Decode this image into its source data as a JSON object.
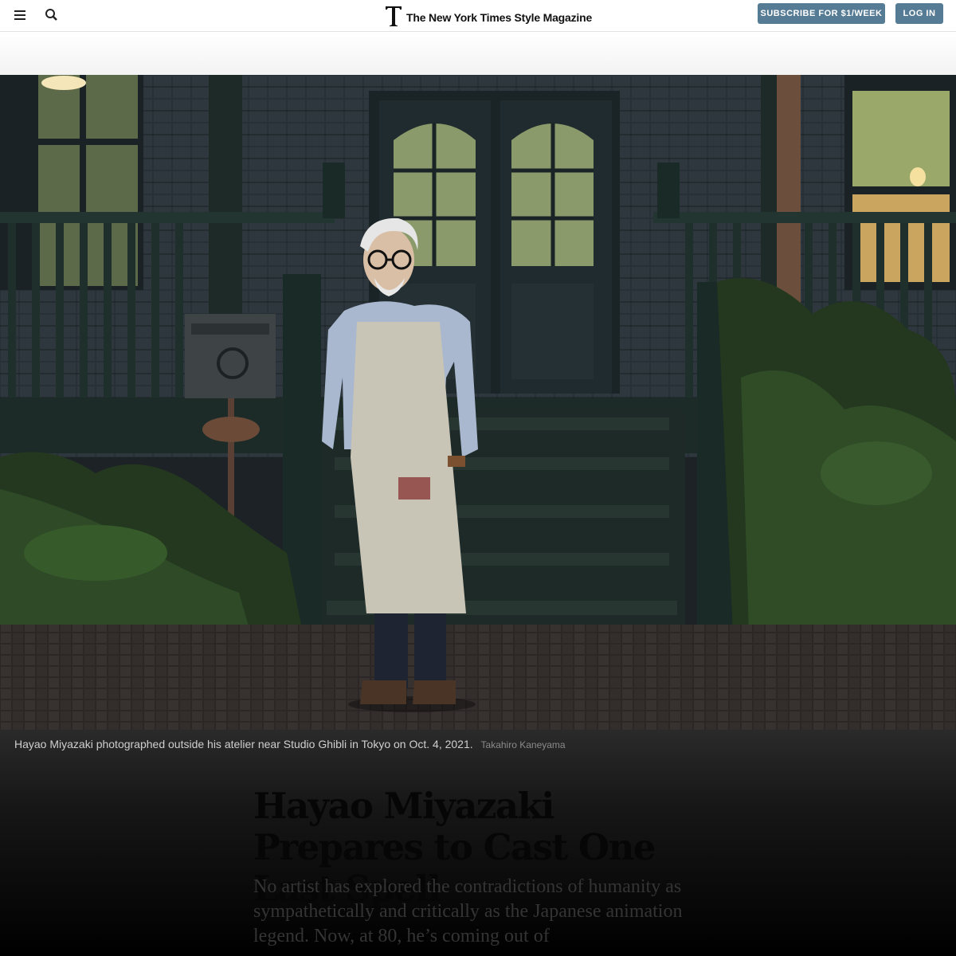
{
  "header": {
    "logo_text": "The New York Times Style Magazine",
    "subscribe_label": "SUBSCRIBE FOR $1/WEEK",
    "login_label": "LOG IN",
    "menu_icon": "hamburger-menu-icon",
    "search_icon": "search-icon",
    "accent_color": "#567b95"
  },
  "hero": {
    "caption": "Hayao Miyazaki photographed outside his atelier near Studio Ghibli in Tokyo on Oct. 4, 2021.",
    "credit": "Takahiro Kaneyama"
  },
  "article": {
    "headline": "Hayao Miyazaki Prepares to Cast One Last Spell",
    "summary": "No artist has explored the contradictions of humanity as sympathetically and critically as the Japanese animation legend. Now, at 80, he’s coming out of"
  }
}
